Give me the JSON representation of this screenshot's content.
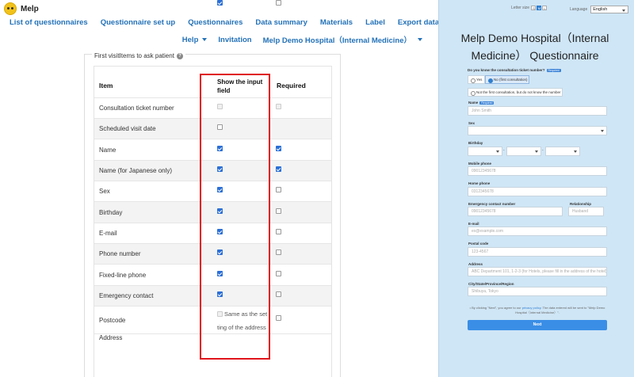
{
  "app": {
    "name": "Melp"
  },
  "nav": {
    "primary": [
      "List of questionnaires",
      "Questionnaire set up",
      "Questionnaires",
      "Data summary",
      "Materials",
      "Label",
      "Export data"
    ],
    "help": "Help",
    "invitation": "Invitation",
    "hospital": "Melp Demo Hospital（Internal Medicine）"
  },
  "card": {
    "legend": "First visitItems to ask patient",
    "columns": {
      "item": "Item",
      "show": "Show the input field",
      "required": "Required"
    },
    "rows": [
      {
        "label": "Consultation ticket number",
        "show": "disabled",
        "required": "disabled"
      },
      {
        "label": "Scheduled visit date",
        "show": "off",
        "required": "none"
      },
      {
        "label": "Name",
        "show": "on",
        "required": "on"
      },
      {
        "label": "Name (for Japanese only)",
        "show": "on",
        "required": "on"
      },
      {
        "label": "Sex",
        "show": "on",
        "required": "off"
      },
      {
        "label": "Birthday",
        "show": "on",
        "required": "off"
      },
      {
        "label": "E-mail",
        "show": "on",
        "required": "off"
      },
      {
        "label": "Phone number",
        "show": "on",
        "required": "off"
      },
      {
        "label": "Fixed-line phone",
        "show": "on",
        "required": "off"
      },
      {
        "label": "Emergency contact",
        "show": "on",
        "required": "off"
      },
      {
        "label": "Postcode",
        "show": "disabled",
        "required": "off",
        "note_lines": [
          "Same as the set",
          "ting of the address"
        ]
      },
      {
        "label": "Address",
        "show": "on",
        "required": "off"
      }
    ]
  },
  "preview": {
    "letter_size": {
      "label": "Letter size",
      "options": [
        "S",
        "M",
        "L"
      ],
      "selected": "M"
    },
    "language": {
      "label": "Language",
      "value": "English"
    },
    "title": "Melp Demo Hospital（Internal Medicine） Questionnaire",
    "ticket": {
      "question": "Do you know the consultation ticket number?",
      "badge": "Required",
      "options": [
        "Yes",
        "No (first consultation)",
        "Not the first consultation, but do not know the number"
      ],
      "selected": 1
    },
    "fields": {
      "name": {
        "label": "Name",
        "badge": "Required",
        "placeholder": "John Smith"
      },
      "sex": {
        "label": "Sex"
      },
      "birthday": {
        "label": "Birthday"
      },
      "mobile": {
        "label": "Mobile phone",
        "placeholder": "09012345678"
      },
      "home": {
        "label": "Home phone",
        "placeholder": "0312345678"
      },
      "emergency": {
        "label": "Emergency contact number",
        "placeholder": "09012345678"
      },
      "relationship": {
        "label": "Relationship",
        "placeholder": "Husband"
      },
      "email": {
        "label": "E-mail",
        "placeholder": "ex@example.com"
      },
      "postal": {
        "label": "Postal code",
        "placeholder": "123-4567"
      },
      "address": {
        "label": "Address",
        "placeholder": "ABC Department 101, 1-2-3 (for Hotels, please fill in the address of the hotel)"
      },
      "city": {
        "label": "City/State/Province/Region",
        "placeholder": "Shibuya, Tokyo"
      }
    },
    "terms": {
      "before": "• By clicking \"Next\", you agree to our",
      "link": "privacy policy",
      "after": ". The data entered will be sent to \"Melp Demo Hospital（Internal Medicine）\"."
    },
    "next": "Next"
  }
}
